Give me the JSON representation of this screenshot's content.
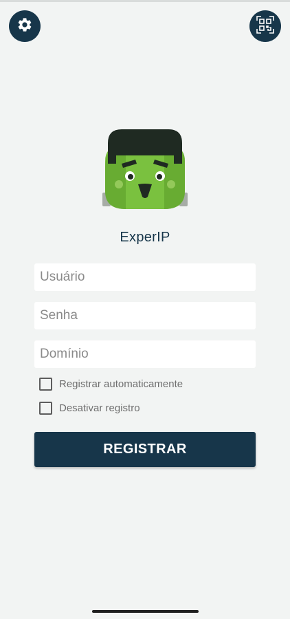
{
  "app": {
    "name": "ExperIP"
  },
  "toolbar": {
    "settings_icon": "gear-icon",
    "qr_icon": "qr-scan-icon"
  },
  "form": {
    "username": {
      "placeholder": "Usuário",
      "value": ""
    },
    "password": {
      "placeholder": "Senha",
      "value": ""
    },
    "domain": {
      "placeholder": "Domínio",
      "value": ""
    },
    "auto_register": {
      "label": "Registrar automaticamente",
      "checked": false
    },
    "disable_register": {
      "label": "Desativar registro",
      "checked": false
    },
    "submit_label": "REGISTRAR"
  },
  "colors": {
    "primary": "#17364a",
    "background": "#f2f4f3",
    "mascot_green": "#7ac13f"
  }
}
